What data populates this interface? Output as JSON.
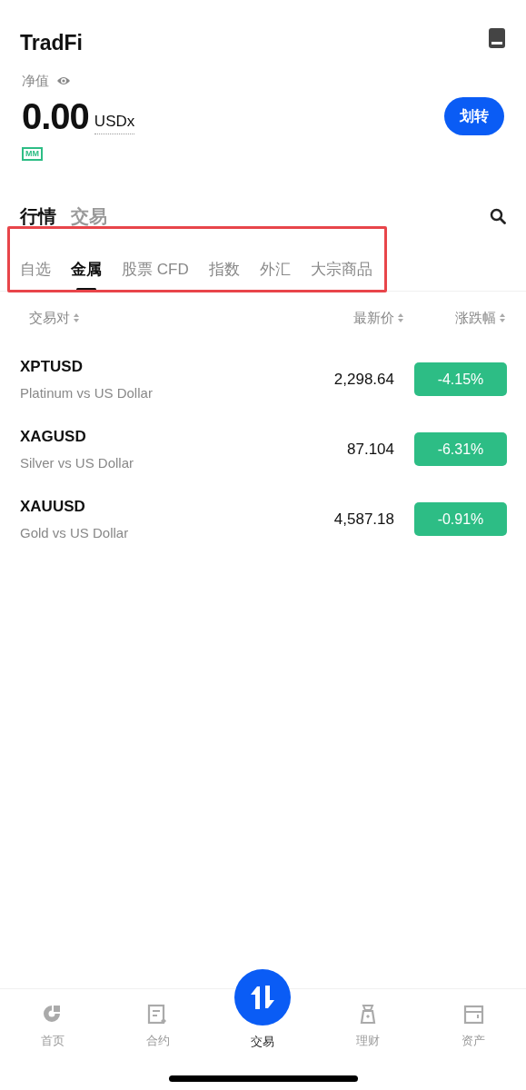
{
  "header": {
    "title": "TradFi"
  },
  "balance": {
    "label": "净值",
    "amount": "0.00",
    "unit": "USDx",
    "transfer_button": "划转",
    "badge": "MM"
  },
  "main_tabs": [
    {
      "label": "行情",
      "selected": true
    },
    {
      "label": "交易",
      "selected": false
    }
  ],
  "category_tabs": [
    {
      "label": "自选",
      "selected": false
    },
    {
      "label": "金属",
      "selected": true
    },
    {
      "label": "股票 CFD",
      "selected": false
    },
    {
      "label": "指数",
      "selected": false
    },
    {
      "label": "外汇",
      "selected": false
    },
    {
      "label": "大宗商品",
      "selected": false
    }
  ],
  "category_tabs_highlighted": true,
  "table": {
    "columns": [
      "交易对",
      "最新价",
      "涨跌幅"
    ],
    "rows": [
      {
        "symbol": "XPTUSD",
        "name": "Platinum vs US Dollar",
        "price": "2,298.64",
        "change": "-4.15%"
      },
      {
        "symbol": "XAGUSD",
        "name": "Silver vs US Dollar",
        "price": "87.104",
        "change": "-6.31%"
      },
      {
        "symbol": "XAUUSD",
        "name": "Gold vs US Dollar",
        "price": "4,587.18",
        "change": "-0.91%"
      }
    ]
  },
  "bottom_nav": [
    {
      "label": "首页",
      "kind": "home",
      "selected": false
    },
    {
      "label": "合约",
      "kind": "contract",
      "selected": false
    },
    {
      "label": "交易",
      "kind": "trade",
      "selected": true
    },
    {
      "label": "理财",
      "kind": "finance",
      "selected": false
    },
    {
      "label": "资产",
      "kind": "assets",
      "selected": false
    }
  ]
}
